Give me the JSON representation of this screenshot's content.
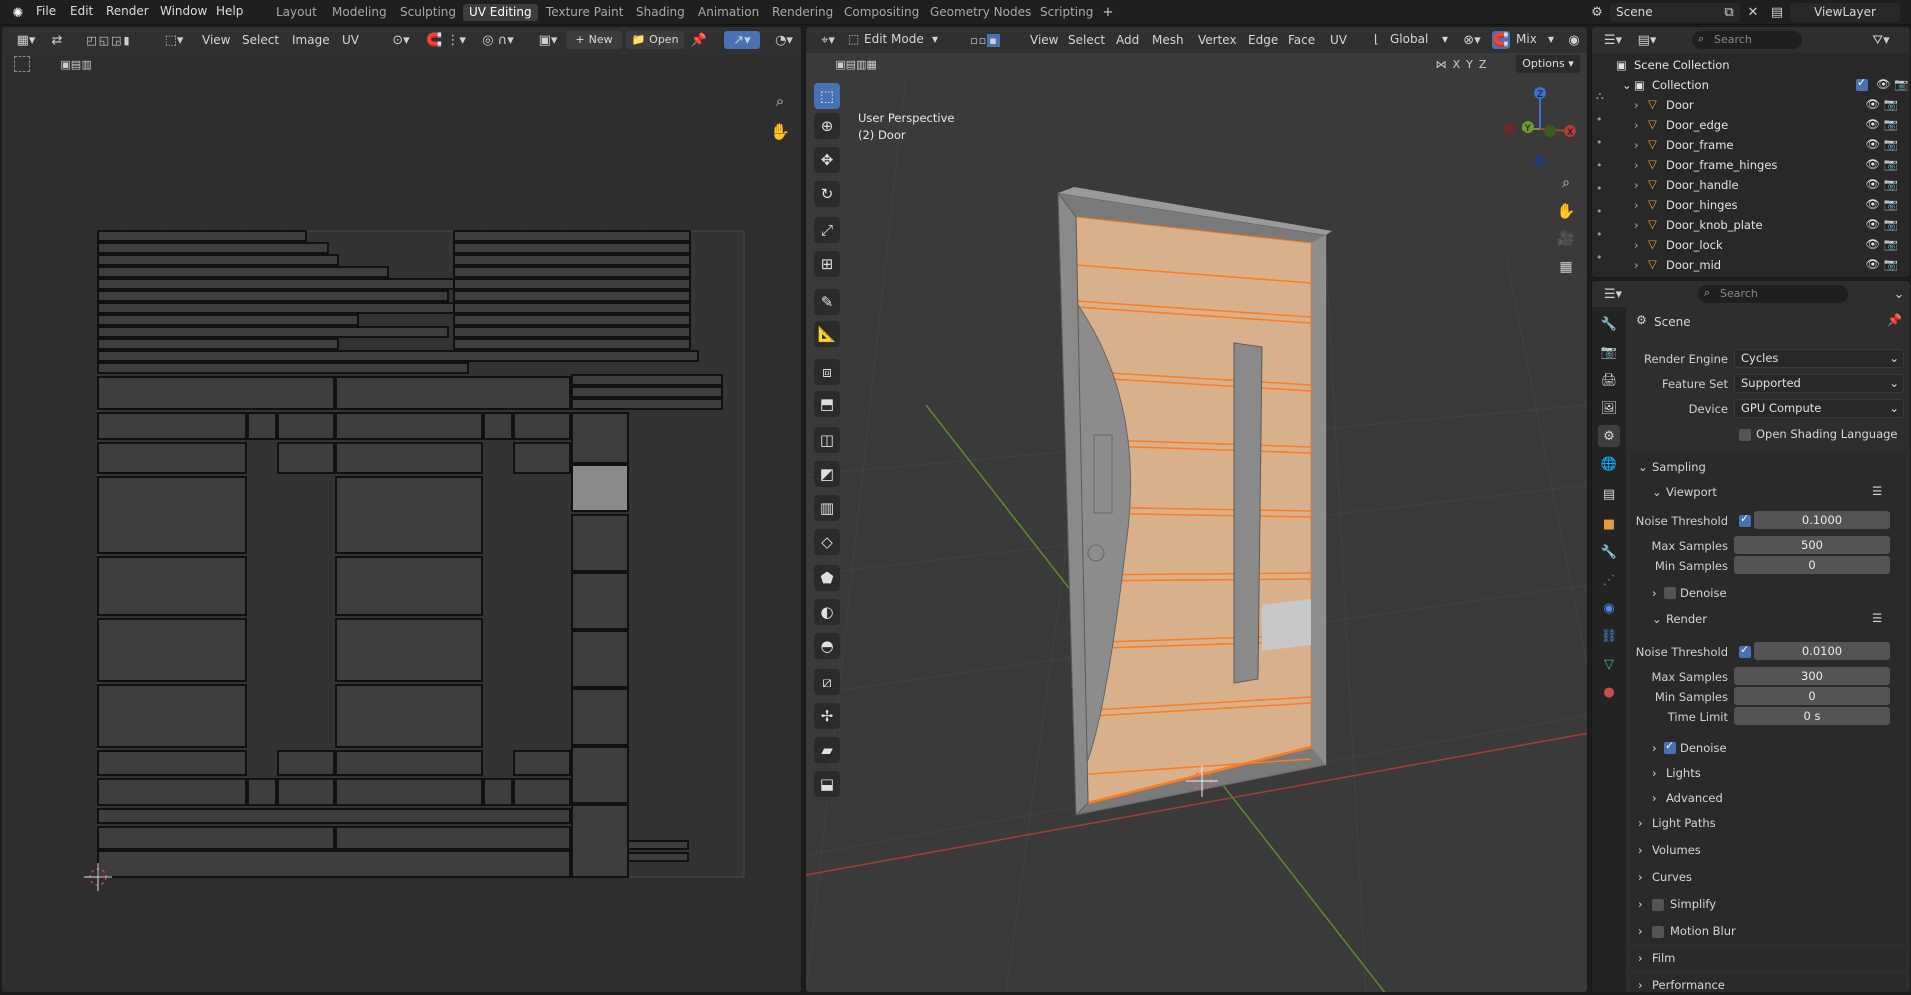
{
  "menus": [
    "File",
    "Edit",
    "Render",
    "Window",
    "Help"
  ],
  "workspaces": [
    "Layout",
    "Modeling",
    "Sculpting",
    "UV Editing",
    "Texture Paint",
    "Shading",
    "Animation",
    "Rendering",
    "Compositing",
    "Geometry Nodes",
    "Scripting"
  ],
  "active_workspace": "UV Editing",
  "scene_name": "Scene",
  "view_layer": "ViewLayer",
  "uv_editor": {
    "menus": [
      "View",
      "Select",
      "Image",
      "UV"
    ],
    "new_label": "New",
    "open_label": "Open"
  },
  "viewport": {
    "mode": "Edit Mode",
    "menus": [
      "View",
      "Select",
      "Add",
      "Mesh",
      "Vertex",
      "Edge",
      "Face",
      "UV"
    ],
    "orientation": "Global",
    "pivot": "Mix",
    "options_label": "Options",
    "axes": [
      "X",
      "Y",
      "Z"
    ],
    "overlay_title": "User Perspective",
    "overlay_object": "(2) Door"
  },
  "outliner": {
    "search_placeholder": "Search",
    "collection_root": "Scene Collection",
    "collection": "Collection",
    "objects": [
      "Door",
      "Door_edge",
      "Door_frame",
      "Door_frame_hinges",
      "Door_handle",
      "Door_hinges",
      "Door_knob_plate",
      "Door_lock",
      "Door_mid"
    ]
  },
  "properties": {
    "search_placeholder": "Search",
    "context": "Scene",
    "render_engine_label": "Render Engine",
    "render_engine": "Cycles",
    "feature_set_label": "Feature Set",
    "feature_set": "Supported",
    "device_label": "Device",
    "device": "GPU Compute",
    "osl_label": "Open Shading Language",
    "sampling": "Sampling",
    "viewport_sub": "Viewport",
    "noise_threshold_label": "Noise Threshold",
    "vp_noise": "0.1000",
    "max_samples_label": "Max Samples",
    "vp_max": "500",
    "min_samples_label": "Min Samples",
    "vp_min": "0",
    "denoise_label": "Denoise",
    "render_sub": "Render",
    "r_noise": "0.0100",
    "r_max": "300",
    "r_min": "0",
    "time_limit_label": "Time Limit",
    "r_time": "0 s",
    "lights": "Lights",
    "advanced": "Advanced",
    "panels": [
      "Light Paths",
      "Volumes",
      "Curves",
      "Simplify",
      "Motion Blur",
      "Film",
      "Performance"
    ]
  },
  "colors": {
    "accent": "#4772b3",
    "selected_face": "#e8b893",
    "edge_highlight": "#ff7a1f",
    "x_axis": "#b03c3c",
    "y_axis": "#6c9a2f",
    "z_axis": "#3d6fcf"
  }
}
